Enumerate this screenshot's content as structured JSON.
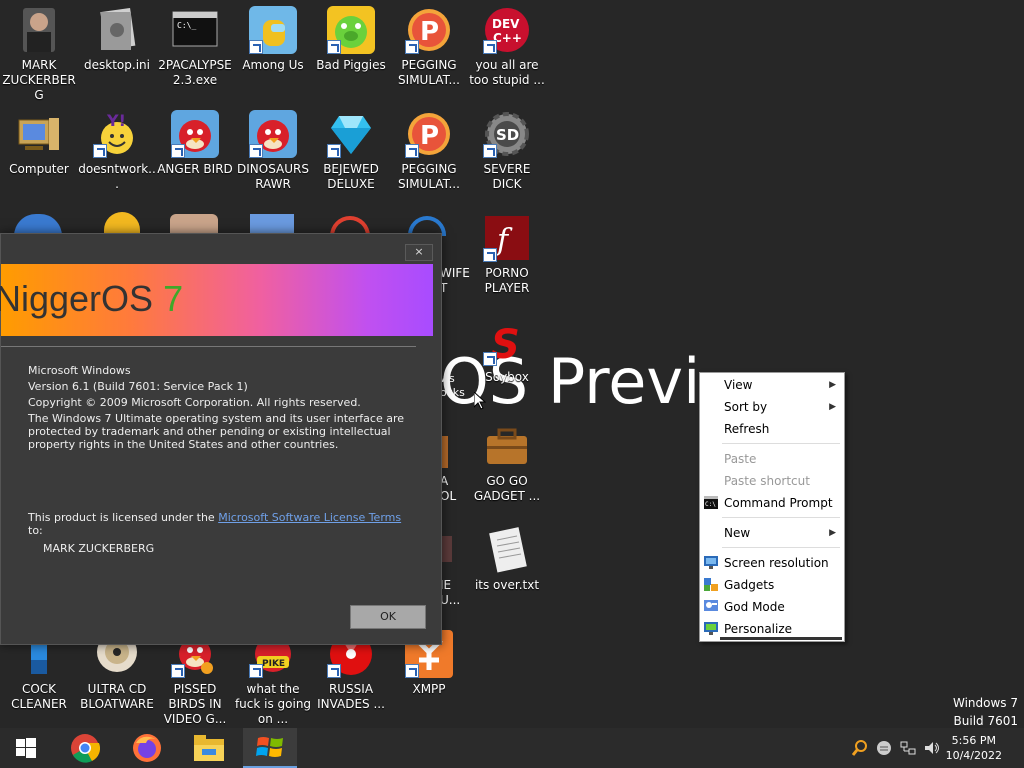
{
  "desktop": {
    "icons": [
      {
        "label": "MARK ZUCKERBERG",
        "icon": "person-icon",
        "color": "#444444"
      },
      {
        "label": "desktop.ini",
        "icon": "settings-file-icon",
        "color": "#9a9a9a"
      },
      {
        "label": "2PACALYPSE 2.3.exe",
        "icon": "console-app-icon",
        "color": "#111111"
      },
      {
        "label": "Among Us",
        "icon": "among-us-icon",
        "color": "#6fb8e8"
      },
      {
        "label": "Bad Piggies",
        "icon": "pig-icon",
        "color": "#6ad13c"
      },
      {
        "label": "PEGGING SIMULAT...",
        "icon": "p-logo-icon",
        "color": "#e8543a"
      },
      {
        "label": "you all are too stupid ...",
        "icon": "dev-cpp-icon",
        "color": "#c8102e"
      },
      {
        "label": "Computer",
        "icon": "computer-icon",
        "color": "#c9a457"
      },
      {
        "label": "doesntwork...",
        "icon": "yahoo-messenger-icon",
        "color": "#6a2a9a"
      },
      {
        "label": "ANGER BIRD",
        "icon": "angry-bird-icon",
        "color": "#d8202a"
      },
      {
        "label": "DINOSAURS RAWR",
        "icon": "angry-bird-icon",
        "color": "#d8202a"
      },
      {
        "label": "BEJEWED DELUXE",
        "icon": "diamond-icon",
        "color": "#34c0ef"
      },
      {
        "label": "PEGGING SIMULAT...",
        "icon": "p-logo-icon",
        "color": "#e8543a"
      },
      {
        "label": "SEVERE DICK",
        "icon": "gear-sd-icon",
        "color": "#4a4a4a"
      },
      {
        "label": "PORNO PLAYER",
        "icon": "flash-icon",
        "color": "#8a0d12"
      },
      {
        "label": "Soybox",
        "icon": "soybox-icon",
        "color": "#e01010"
      },
      {
        "label": "GO GO GADGET ...",
        "icon": "briefcase-icon",
        "color": "#b7742a"
      },
      {
        "label": "its over.txt",
        "icon": "text-file-icon",
        "color": "#eeeeee"
      },
      {
        "label": "COCK CLEANER",
        "icon": "cleaner-icon",
        "color": "#2a8adf"
      },
      {
        "label": "ULTRA CD BLOATWARE",
        "icon": "cd-icon",
        "color": "#c9b48a"
      },
      {
        "label": "PISSED BIRDS IN VIDEO G...",
        "icon": "angry-bird-icon",
        "color": "#d8202a"
      },
      {
        "label": "what the fuck is going on ...",
        "icon": "angry-birds-space-icon",
        "color": "#1a1a4a"
      },
      {
        "label": "RUSSIA INVADES ...",
        "icon": "radiation-icon",
        "color": "#e01010"
      },
      {
        "label": "XMPP",
        "icon": "xampp-icon",
        "color": "#f07a2a"
      }
    ],
    "partial_labels": [
      "WIFE",
      "T",
      "ws",
      "ocks",
      "A",
      "OL",
      "IE",
      "U..."
    ],
    "watermark": "OS Previ",
    "build": {
      "line1": "Windows 7",
      "line2": "Build 7601"
    }
  },
  "about": {
    "brand_main": "NiggerOS",
    "brand_seven": "7",
    "close": "×",
    "lines": [
      "Microsoft Windows",
      "Version 6.1 (Build 7601: Service Pack 1)",
      "Copyright © 2009 Microsoft Corporation.  All rights reserved.",
      "The Windows 7 Ultimate operating system and its user interface are protected by trademark and other pending or existing intellectual property rights in the United States and other countries."
    ],
    "license_prefix": "This product is licensed under the ",
    "license_link": "Microsoft Software License Terms",
    "license_suffix": " to:",
    "owner": "MARK ZUCKERBERG",
    "ok": "OK"
  },
  "context_menu": {
    "items": [
      {
        "label": "View",
        "submenu": true,
        "disabled": false,
        "icon": ""
      },
      {
        "label": "Sort by",
        "submenu": true,
        "disabled": false,
        "icon": ""
      },
      {
        "label": "Refresh",
        "submenu": false,
        "disabled": false,
        "icon": ""
      },
      {
        "label": "Paste",
        "submenu": false,
        "disabled": true,
        "icon": ""
      },
      {
        "label": "Paste shortcut",
        "submenu": false,
        "disabled": true,
        "icon": ""
      },
      {
        "label": "Command Prompt",
        "submenu": false,
        "disabled": false,
        "icon": "console-icon"
      },
      {
        "label": "New",
        "submenu": true,
        "disabled": false,
        "icon": ""
      },
      {
        "label": "Screen resolution",
        "submenu": false,
        "disabled": false,
        "icon": "monitor-icon"
      },
      {
        "label": "Gadgets",
        "submenu": false,
        "disabled": false,
        "icon": "gadgets-icon"
      },
      {
        "label": "God Mode",
        "submenu": false,
        "disabled": false,
        "icon": "control-panel-icon"
      },
      {
        "label": "Personalize",
        "submenu": false,
        "disabled": false,
        "icon": "personalize-icon"
      }
    ]
  },
  "taskbar": {
    "buttons": [
      {
        "name": "start-button",
        "icon": "windows-logo-icon"
      },
      {
        "name": "chrome-button",
        "icon": "chrome-icon"
      },
      {
        "name": "firefox-button",
        "icon": "firefox-icon"
      },
      {
        "name": "explorer-button",
        "icon": "folder-icon"
      },
      {
        "name": "windows7-app-button",
        "icon": "windows7-flag-icon"
      }
    ],
    "time": "5:56 PM",
    "date": "10/4/2022"
  },
  "colors": {
    "desktop_bg": "#272727",
    "taskbar_bg": "#2b2b2b",
    "accent": "#6aa0e0"
  }
}
